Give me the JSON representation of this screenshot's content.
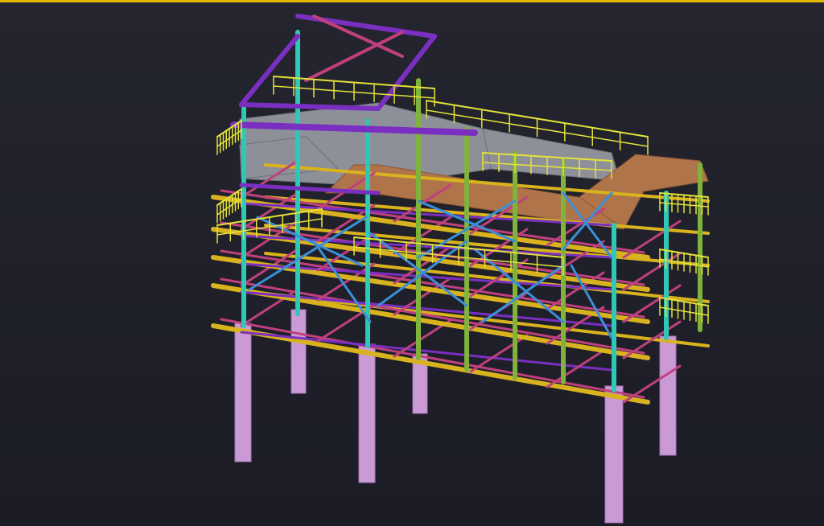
{
  "viewport": {
    "background": "#1e1f2b",
    "accent_border": "#e6b800"
  },
  "model": {
    "colors": {
      "column_cyan": "#2fc8b4",
      "column_green": "#7fb33c",
      "beam_yellow": "#d9b21f",
      "beam_magenta": "#c0407e",
      "beam_purple": "#7a2fc0",
      "brace_blue": "#3a8fd8",
      "handrail_yellow": "#e4e23a",
      "grating_gray": "#8d8f99",
      "plate_brown": "#b0744a",
      "pedestal_lilac": "#c99ad6"
    }
  }
}
